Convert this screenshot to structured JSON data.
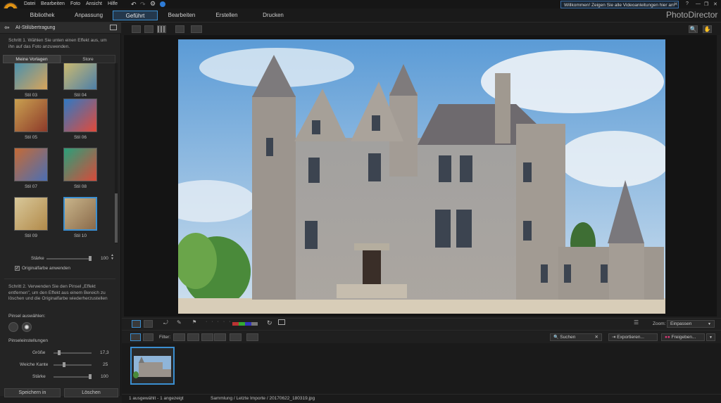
{
  "menu": [
    "Datei",
    "Bearbeiten",
    "Foto",
    "Ansicht",
    "Hilfe"
  ],
  "notice": "Willkommen! Zeigen Sie alle Videoanleitungen hier an!",
  "window_buttons": [
    "?",
    "—",
    "❐",
    "✕"
  ],
  "module_tabs": [
    "Bibliothek",
    "Anpassung",
    "Geführt",
    "Bearbeiten",
    "Erstellen",
    "Drucken"
  ],
  "active_tab": "Geführt",
  "brand": "PhotoDirector",
  "left_panel": {
    "title": "AI-Stilübertragung",
    "step1": "Schritt 1. Wählen Sie unten einen Effekt aus, um ihn auf das Foto anzuwenden.",
    "tabs": [
      "Meine Vorlagen",
      "Store"
    ],
    "styles": [
      {
        "label": "Stil 03",
        "c1": "#3c8fb6",
        "c2": "#d8a45a"
      },
      {
        "label": "Stil 04",
        "c1": "#d8c06a",
        "c2": "#4d7fa8"
      },
      {
        "label": "Stil 05",
        "c1": "#c9a050",
        "c2": "#8d3a2a"
      },
      {
        "label": "Stil 06",
        "c1": "#2f79c4",
        "c2": "#e24a3a"
      },
      {
        "label": "Stil 07",
        "c1": "#c46a36",
        "c2": "#4b6fb4"
      },
      {
        "label": "Stil 08",
        "c1": "#2aa07a",
        "c2": "#d84a3a"
      },
      {
        "label": "Stil 09",
        "c1": "#d8c89a",
        "c2": "#b28a4a"
      },
      {
        "label": "Stil 10",
        "c1": "#c8b48a",
        "c2": "#8a6a4a"
      }
    ],
    "selected_style": "Stil 10",
    "strength_label": "Stärke",
    "strength_value": "100",
    "strength_fraction": 1.0,
    "original_color_label": "Originalfarbe anwenden",
    "original_color_checked": true,
    "step2": "Schritt 2. Verwenden Sie den Pinsel „Effekt entfernen\", um den Effekt aus einem Bereich zu löschen und die Originalfarbe wiederherzustellen",
    "brush_select_label": "Pinsel auswählen:",
    "brush_settings_label": "Pinseleinstellungen",
    "brush_settings": [
      {
        "label": "Größe",
        "value": "17,3",
        "fraction": 0.12
      },
      {
        "label": "Weiche Kante",
        "value": "25",
        "fraction": 0.25
      },
      {
        "label": "Stärke",
        "value": "100",
        "fraction": 1.0
      }
    ],
    "save_label": "Speichern in",
    "delete_label": "Löschen"
  },
  "filter_bar": {
    "filter_label": "Filter:",
    "search_placeholder": "Suchen",
    "zoom_label": "Zoom:",
    "zoom_value": "Einpassen",
    "export_label": "Exportieren...",
    "share_label": "Freigeben..."
  },
  "status": {
    "selection": "1 ausgewählt - 1 angezeigt",
    "path": "Sammlung / Letzte Importe / 20170622_180319.jpg"
  },
  "colors": {
    "accent": "#3b8fd1",
    "background": "#1e1e1e"
  }
}
